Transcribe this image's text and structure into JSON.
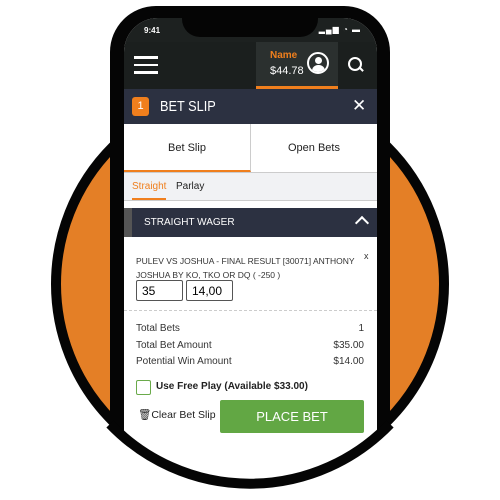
{
  "colors": {
    "accent": "#f07f1d",
    "header": "#1b1f1e",
    "slipbar": "#2c3141",
    "place_bet": "#62a744",
    "circle": "#e47f26"
  },
  "status": {
    "time": "9:41",
    "icons": "signal wifi battery"
  },
  "header": {
    "menu_icon": "hamburger-icon",
    "account_name": "Name",
    "balance": "$44.78",
    "avatar_icon": "user-avatar-icon",
    "search_icon": "search-icon"
  },
  "betslip_bar": {
    "count": "1",
    "title": "BET SLIP",
    "close": "✕"
  },
  "tabs": [
    {
      "label": "Bet Slip",
      "active": true
    },
    {
      "label": "Open Bets",
      "active": false
    }
  ],
  "subtabs": [
    {
      "label": "Straight",
      "active": true
    },
    {
      "label": "Parlay",
      "active": false
    }
  ],
  "wager": {
    "title": "STRAIGHT WAGER",
    "description": "PULEV VS JOSHUA - FINAL RESULT [30071] ANTHONY JOSHUA BY KO, TKO OR DQ ( -250 )",
    "remove": "x",
    "risk": "35",
    "win": "14,00"
  },
  "totals": [
    {
      "label": "Total Bets",
      "value": "1"
    },
    {
      "label": "Total Bet Amount",
      "value": "$35.00"
    },
    {
      "label": "Potential Win Amount",
      "value": "$14.00"
    }
  ],
  "free_play": {
    "label": "Use Free Play (Available $33.00)",
    "checked": false
  },
  "actions": {
    "clear": "Clear Bet Slip",
    "place": "PLACE BET"
  }
}
